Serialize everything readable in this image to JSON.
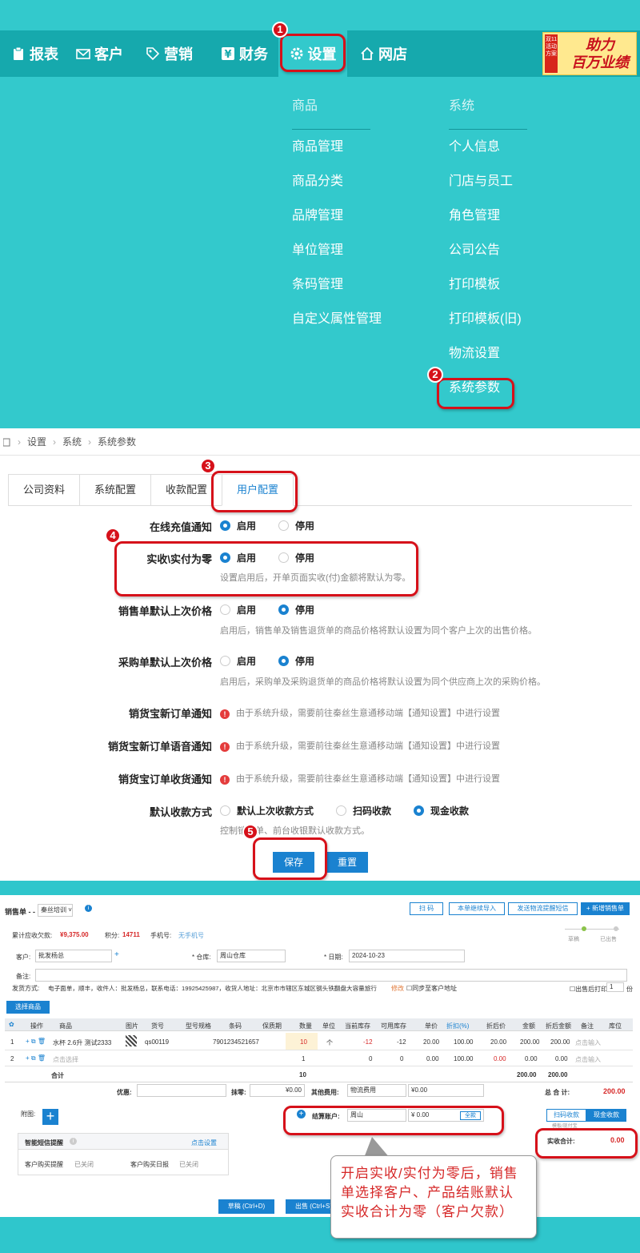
{
  "nav": {
    "items": [
      {
        "label": "报表",
        "icon": "clipboard-icon"
      },
      {
        "label": "客户",
        "icon": "mail-icon"
      },
      {
        "label": "营销",
        "icon": "tag-icon"
      },
      {
        "label": "财务",
        "icon": "yen-icon"
      },
      {
        "label": "设置",
        "icon": "gear-icon"
      },
      {
        "label": "网店",
        "icon": "home-icon"
      }
    ],
    "promo_side": "双11活动方案",
    "promo_line1": "助力",
    "promo_line2": "百万业绩"
  },
  "dropdown": {
    "col1_title": "商品",
    "col1_items": [
      "商品管理",
      "商品分类",
      "品牌管理",
      "单位管理",
      "条码管理",
      "自定义属性管理"
    ],
    "col2_title": "系统",
    "col2_items": [
      "个人信息",
      "门店与员工",
      "角色管理",
      "公司公告",
      "打印模板",
      "打印模板(旧)",
      "物流设置",
      "系统参数"
    ]
  },
  "steps": [
    "1",
    "2",
    "3",
    "4",
    "5"
  ],
  "breadcrumb": [
    "设置",
    "系统",
    "系统参数"
  ],
  "tabs": [
    "公司资料",
    "系统配置",
    "收款配置",
    "用户配置"
  ],
  "settings": {
    "online_recharge": {
      "label": "在线充值通知",
      "on": "启用",
      "off": "停用"
    },
    "zero_paid": {
      "label": "实收\\实付为零",
      "on": "启用",
      "off": "停用",
      "hint": "设置启用后，开单页面实收(付)金额将默认为零。"
    },
    "sale_last_price": {
      "label": "销售单默认上次价格",
      "on": "启用",
      "off": "停用",
      "hint": "启用后，销售单及销售退货单的商品价格将默认设置为同个客户上次的出售价格。"
    },
    "purchase_last_price": {
      "label": "采购单默认上次价格",
      "on": "启用",
      "off": "停用",
      "hint": "启用后，采购单及采购退货单的商品价格将默认设置为同个供应商上次的采购价格。"
    },
    "notice_text": "由于系统升级，需要前往秦丝生意通移动端【通知设置】中进行设置",
    "xhb_new_order": "销货宝新订单通知",
    "xhb_voice": "销货宝新订单语音通知",
    "xhb_receive": "销货宝订单收货通知",
    "default_payment": {
      "label": "默认收款方式",
      "opt1": "默认上次收款方式",
      "opt2": "扫码收款",
      "opt3": "现金收款",
      "hint": "控制销售单、前台收银默认收款方式。"
    },
    "save": "保存",
    "reset": "重置"
  },
  "sale": {
    "title": "销售单 - -",
    "store": "秦丝培训",
    "btn_scan": "扫 码",
    "btn_import": "本单继续导入",
    "btn_sms": "发送物流提醒短信",
    "btn_new": "+ 新增销售单",
    "debt_label": "累计应收欠款:",
    "debt": "¥9,375.00",
    "points_label": "积分:",
    "points": "14711",
    "phone_label": "手机号:",
    "phone": "无手机号",
    "progress1": "草稿",
    "progress2": "已出售",
    "customer_label": "客户:",
    "customer": "批发杨总",
    "warehouse_label": "* 仓库:",
    "warehouse": "周山仓库",
    "date_label": "* 日期:",
    "date": "2024-10-23",
    "note_label": "备注:",
    "ship_label": "发货方式:",
    "ship_info": "电子面单，顺丰，收件人：批发杨总，联系电话：19925425987，收货人地址：北京市市辖区东城区钢头铁翻盘大容量旅行",
    "ship_edit": "修改",
    "ship_sync": "同步至客户地址",
    "print_after": "出售后打印",
    "print_copies": "1",
    "print_unit": "份",
    "select_goods": "选择商品",
    "columns": [
      "操作",
      "商品",
      "图片",
      "货号",
      "型号规格",
      "条码",
      "保质期",
      "数量",
      "单位",
      "当前库存",
      "可用库存",
      "单价",
      "折扣(%)",
      "折后价",
      "金额",
      "折后金额",
      "备注",
      "库位"
    ],
    "rows": [
      {
        "no": "1",
        "name": "水杯 2.6升 测试2333",
        "code": "qs00119",
        "barcode": "7901234521657",
        "qty": "10",
        "unit": "个",
        "stock": "-12",
        "avail": "-12",
        "price": "20.00",
        "disc": "100.00",
        "dprice": "20.00",
        "amt": "200.00",
        "damt": "200.00",
        "note": "点击输入"
      },
      {
        "no": "2",
        "name": "点击选择",
        "code": "",
        "barcode": "",
        "qty": "1",
        "unit": "",
        "stock": "0",
        "avail": "0",
        "price": "0.00",
        "disc": "100.00",
        "dprice": "0.00",
        "amt": "0.00",
        "damt": "0.00",
        "note": "点击输入"
      }
    ],
    "total_label": "合计",
    "total_qty": "10",
    "total_amt": "200.00",
    "total_damt": "200.00",
    "discount_label": "优惠:",
    "wipe_label": "抹零:",
    "wipe": "¥0.00",
    "other_fee_label": "其他费用:",
    "other_fee_type": "物流费用",
    "other_fee": "¥0.00",
    "grand_label": "总 合 计:",
    "grand": "200.00",
    "attach_label": "附图:",
    "account_label": "结算账户:",
    "account": "周山",
    "account_amt": "¥ 0.00",
    "all_btn": "全款",
    "pay_scan": "扫码收款",
    "pay_cash": "现金收款",
    "pay_small": "模板/现付宝",
    "received_label": "实收合计:",
    "received": "0.00",
    "sms_title": "智能短信提醒",
    "sms_setting": "点击设置",
    "sms1_label": "客户购买提醒",
    "sms1_status": "已关闭",
    "sms2_label": "客户购买日报",
    "sms2_status": "已关闭",
    "draft_btn": "草稿 (Ctrl+D)",
    "sell_btn": "出售 (Ctrl+S)"
  },
  "callout": "开启实收/实付为零后，销售单选择客户、产品结账默认实收合计为零（客户欠款）",
  "colors": {
    "teal": "#33c9cc",
    "teal_dark": "#16a9ad",
    "accent": "#1a82d0",
    "red": "#d6111a"
  }
}
